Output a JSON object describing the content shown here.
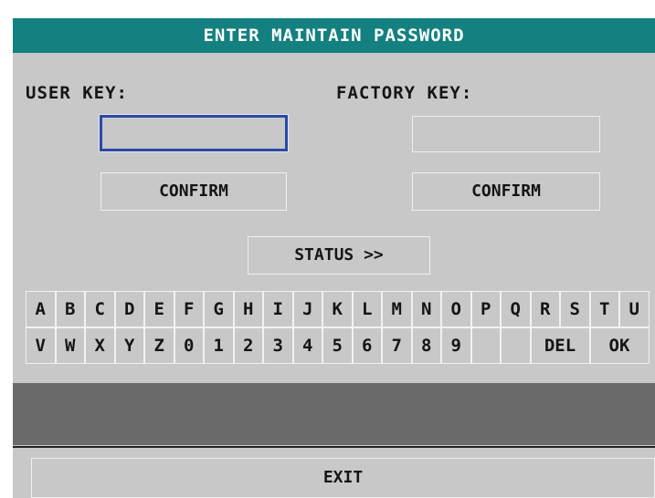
{
  "dialog": {
    "title": "ENTER MAINTAIN PASSWORD"
  },
  "user_key": {
    "label": "USER KEY:",
    "value": "",
    "confirm_label": "CONFIRM"
  },
  "factory_key": {
    "label": "FACTORY KEY:",
    "value": "",
    "confirm_label": "CONFIRM"
  },
  "status_button": {
    "label": "STATUS >>"
  },
  "keyboard": {
    "row1": [
      "A",
      "B",
      "C",
      "D",
      "E",
      "F",
      "G",
      "H",
      "I",
      "J",
      "K",
      "L",
      "M",
      "N",
      "O",
      "P",
      "Q",
      "R",
      "S",
      "T",
      "U"
    ],
    "row2": [
      "V",
      "W",
      "X",
      "Y",
      "Z",
      "0",
      "1",
      "2",
      "3",
      "4",
      "5",
      "6",
      "7",
      "8",
      "9",
      "",
      "",
      "DEL",
      "OK"
    ]
  },
  "message": "",
  "exit_button": {
    "label": "EXIT"
  },
  "colors": {
    "title_bar": "#148080",
    "background": "#c8c8c8",
    "focused_border": "#2a49a8",
    "message_panel": "#6a6a6a"
  }
}
